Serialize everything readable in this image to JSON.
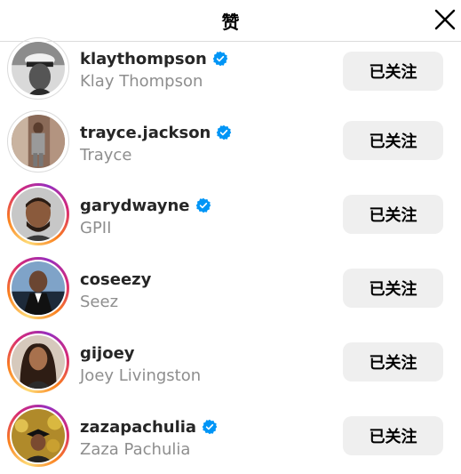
{
  "header": {
    "title": "赞"
  },
  "users": [
    {
      "username": "klaythompson",
      "fullname": "Klay Thompson",
      "verified": true,
      "story": false,
      "button": "已关注"
    },
    {
      "username": "trayce.jackson",
      "fullname": "Trayce",
      "verified": true,
      "story": false,
      "button": "已关注"
    },
    {
      "username": "garydwayne",
      "fullname": "GPII",
      "verified": true,
      "story": true,
      "button": "已关注"
    },
    {
      "username": "coseezy",
      "fullname": "Seez",
      "verified": false,
      "story": true,
      "button": "已关注"
    },
    {
      "username": "gijoey",
      "fullname": "Joey Livingston",
      "verified": false,
      "story": true,
      "button": "已关注"
    },
    {
      "username": "zazapachulia",
      "fullname": "Zaza Pachulia",
      "verified": true,
      "story": true,
      "button": "已关注"
    }
  ],
  "colors": {
    "verified_badge": "#0095f6",
    "follow_button_bg": "#efefef",
    "secondary_text": "#8e8e8e"
  }
}
